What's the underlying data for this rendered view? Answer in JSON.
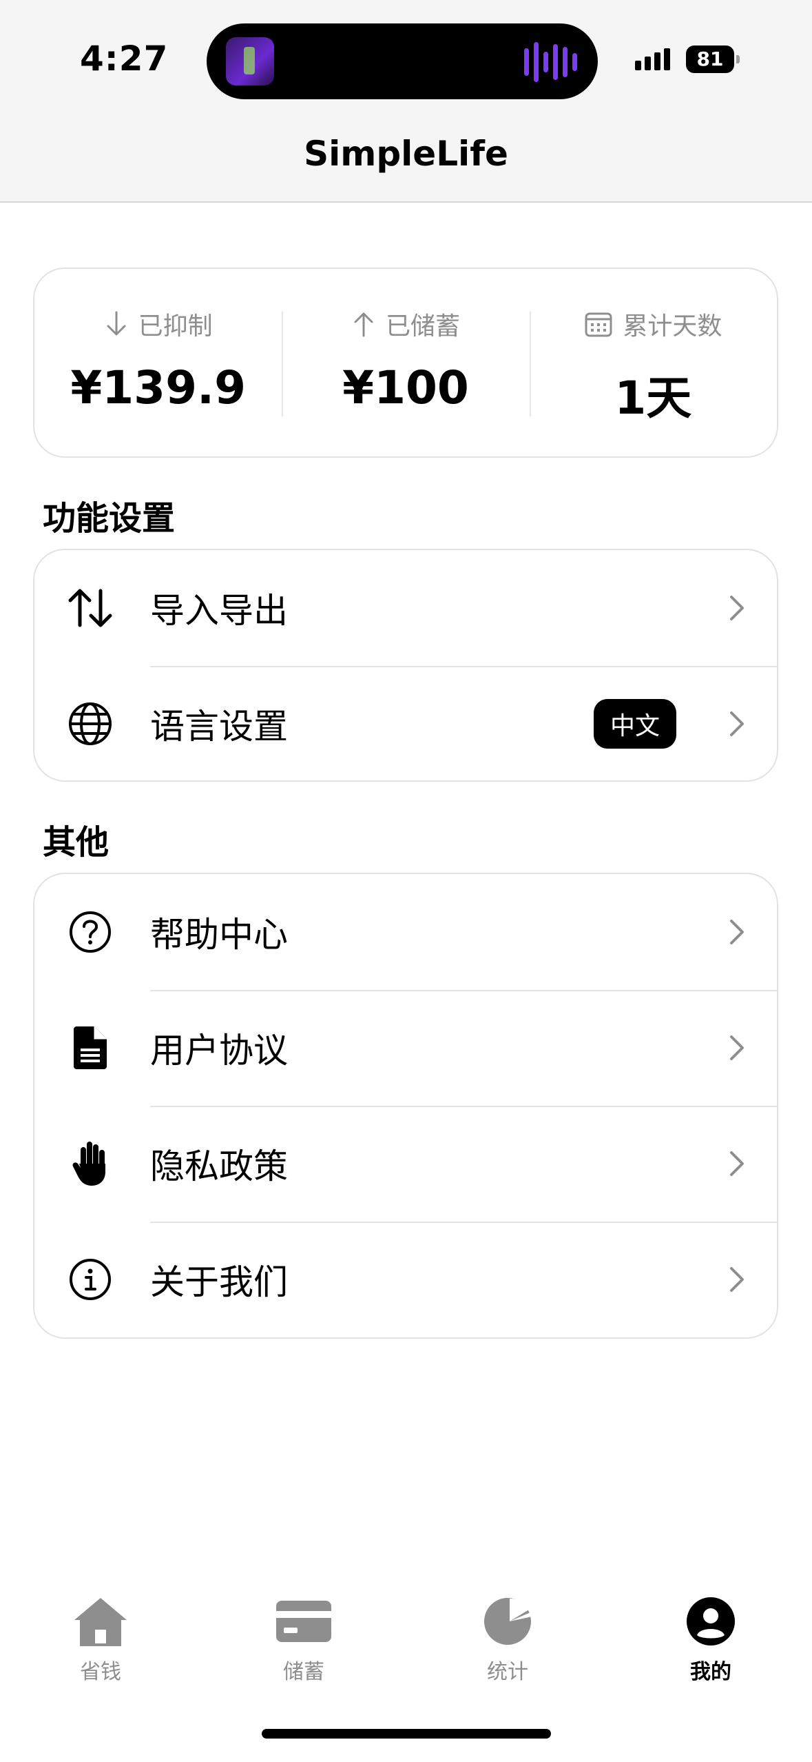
{
  "status_bar": {
    "time": "4:27",
    "battery": "81"
  },
  "nav": {
    "title": "SimpleLife"
  },
  "stats": [
    {
      "icon": "arrow-down-icon",
      "label": "已抑制",
      "value": "¥139.9"
    },
    {
      "icon": "arrow-up-icon",
      "label": "已储蓄",
      "value": "¥100"
    },
    {
      "icon": "calendar-icon",
      "label": "累计天数",
      "value": "1天"
    }
  ],
  "sections": {
    "features": {
      "title": "功能设置",
      "items": [
        {
          "icon": "import-export-icon",
          "label": "导入导出"
        },
        {
          "icon": "globe-icon",
          "label": "语言设置",
          "badge": "中文"
        }
      ]
    },
    "other": {
      "title": "其他",
      "items": [
        {
          "icon": "help-icon",
          "label": "帮助中心"
        },
        {
          "icon": "document-icon",
          "label": "用户协议"
        },
        {
          "icon": "hand-icon",
          "label": "隐私政策"
        },
        {
          "icon": "info-icon",
          "label": "关于我们"
        }
      ]
    }
  },
  "tabs": [
    {
      "icon": "home-icon",
      "label": "省钱",
      "active": false
    },
    {
      "icon": "card-icon",
      "label": "储蓄",
      "active": false
    },
    {
      "icon": "pie-chart-icon",
      "label": "统计",
      "active": false
    },
    {
      "icon": "profile-icon",
      "label": "我的",
      "active": true
    }
  ],
  "colors": {
    "inactive": "#8e8e8e",
    "active": "#000000",
    "badge_bg": "#000000"
  }
}
